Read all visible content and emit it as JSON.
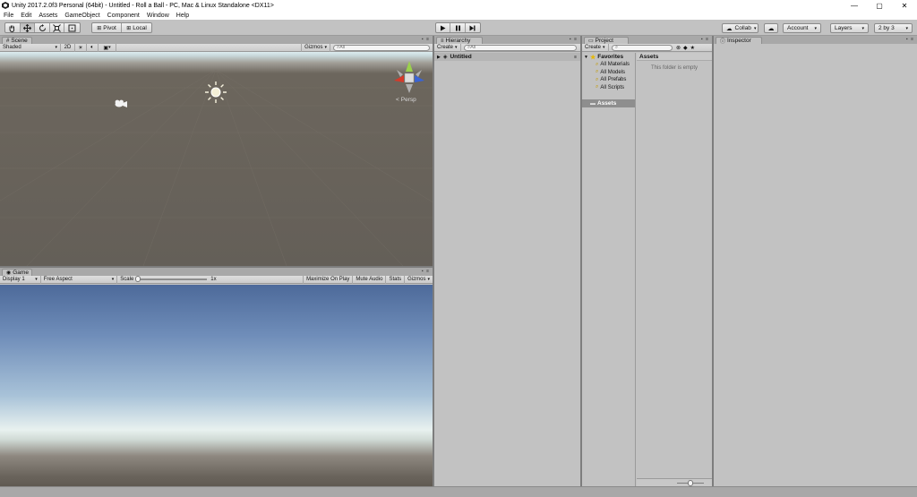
{
  "window": {
    "title": "Unity 2017.2.0f3 Personal (64bit) - Untitled - Roll a Ball - PC, Mac & Linux Standalone <DX11>",
    "controls": [
      "—",
      "▢",
      "✕"
    ]
  },
  "menu": [
    "File",
    "Edit",
    "Assets",
    "GameObject",
    "Component",
    "Window",
    "Help"
  ],
  "toolbar": {
    "pivot": "Pivot",
    "local": "Local",
    "collab": "Collab",
    "account": "Account",
    "layers": "Layers",
    "layout": "2 by 3"
  },
  "scene": {
    "tab": "Scene",
    "shading": "Shaded",
    "mode2d": "2D",
    "gizmos": "Gizmos",
    "search_placeholder": "All",
    "persp": "Persp"
  },
  "game": {
    "tab": "Game",
    "display": "Display 1",
    "aspect": "Free Aspect",
    "scale_label": "Scale",
    "scale_value": "1x",
    "maximize": "Maximize On Play",
    "mute": "Mute Audio",
    "stats": "Stats",
    "gizmos": "Gizmos"
  },
  "hierarchy": {
    "tab": "Hierarchy",
    "create": "Create",
    "search_placeholder": "All",
    "scene_name": "Untitled"
  },
  "project": {
    "tab": "Project",
    "create": "Create",
    "favorites_label": "Favorites",
    "favorites": [
      "All Materials",
      "All Models",
      "All Prefabs",
      "All Scripts"
    ],
    "assets_root": "Assets",
    "assets_header": "Assets",
    "empty_message": "This folder is empty"
  },
  "inspector": {
    "tab": "Inspector"
  }
}
